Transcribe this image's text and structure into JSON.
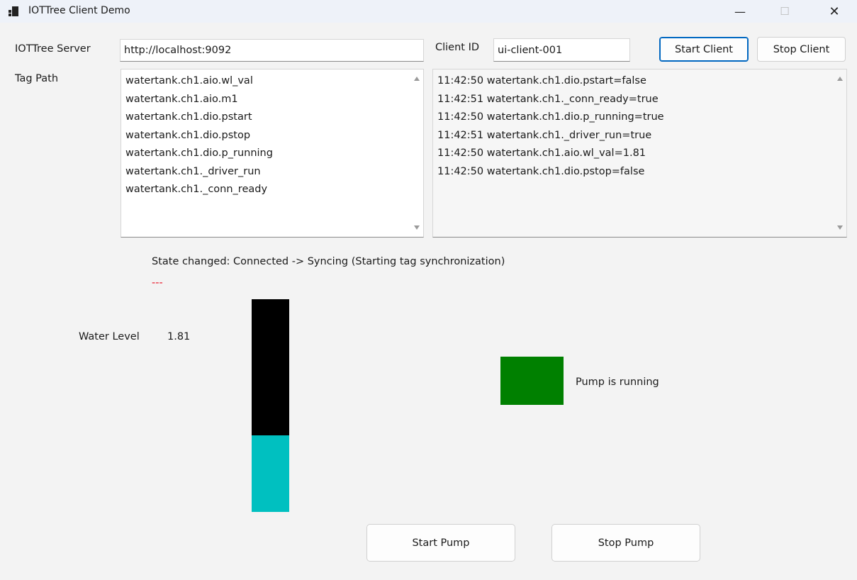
{
  "window": {
    "title": "IOTTree Client Demo",
    "minimize": "—",
    "maximize": "☐",
    "close": "✕"
  },
  "server": {
    "label": "IOTTree Server",
    "value": "http://localhost:9092"
  },
  "client": {
    "label": "Client ID",
    "value": "ui-client-001"
  },
  "buttons": {
    "start_client": "Start Client",
    "stop_client": "Stop Client",
    "start_pump": "Start Pump",
    "stop_pump": "Stop Pump"
  },
  "tags": {
    "label": "Tag Path",
    "items": [
      "watertank.ch1.aio.wl_val",
      "watertank.ch1.aio.m1",
      "watertank.ch1.dio.pstart",
      "watertank.ch1.dio.pstop",
      "watertank.ch1.dio.p_running",
      "watertank.ch1._driver_run",
      "watertank.ch1._conn_ready"
    ]
  },
  "log": {
    "items": [
      "11:42:50 watertank.ch1.dio.pstart=false",
      "11:42:51 watertank.ch1._conn_ready=true",
      "11:42:50 watertank.ch1.dio.p_running=true",
      "11:42:51 watertank.ch1._driver_run=true",
      "11:42:50 watertank.ch1.aio.wl_val=1.81",
      "11:42:50 watertank.ch1.dio.pstop=false"
    ]
  },
  "status": {
    "state_text": "State changed: Connected -> Syncing (Starting tag synchronization)",
    "error_text": "---",
    "error_color": "#e81123"
  },
  "water": {
    "label": "Water Level",
    "value": "1.81",
    "fill_fraction": 0.36,
    "empty_color": "#000000",
    "fill_color": "#00c0c0"
  },
  "pump": {
    "status_text": "Pump is running",
    "indicator_color": "#008000"
  }
}
